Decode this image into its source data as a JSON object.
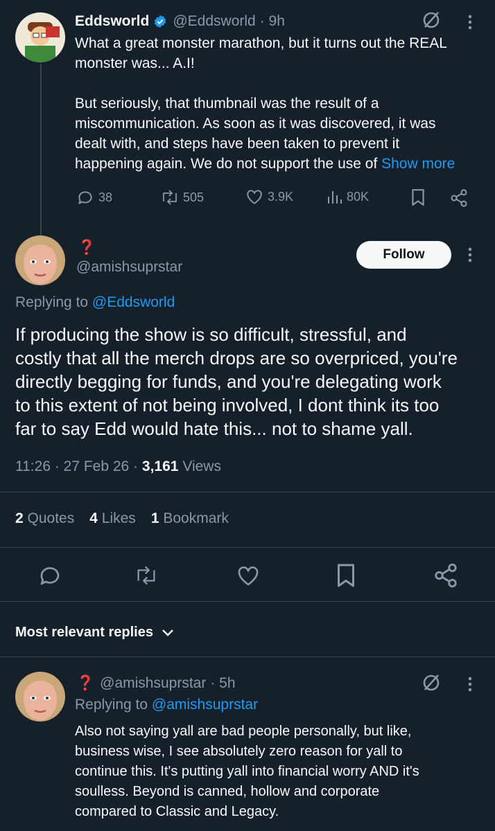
{
  "parent_tweet": {
    "display_name": "Eddsworld",
    "handle": "@Eddsworld",
    "time": "· 9h",
    "text_line1": "What a great monster marathon, but it turns out the REAL",
    "text_line2": "monster was... A.I!",
    "text_line3": "But seriously, that thumbnail was the result of a",
    "text_line4": "miscommunication. As soon as it was discovered, it was",
    "text_line5": "dealt with, and steps have been taken to prevent it",
    "text_line6": "happening again. We do not support the use of",
    "show_more": "Show more",
    "replies": "38",
    "reposts": "505",
    "likes": "3.9K",
    "views": "80K"
  },
  "main_tweet": {
    "display_name_glyph": "❓",
    "handle": "@amishsuprstar",
    "follow_label": "Follow",
    "replying_prefix": "Replying to",
    "replying_handle": "@Eddsworld",
    "body_line1": "If producing the show is so difficult, stressful, and",
    "body_line2": "costly that all the merch drops are so overpriced, you're",
    "body_line3": "directly begging for funds, and you're delegating work",
    "body_line4": "to this extent of not being involved, I dont think its too",
    "body_line5": "far to say Edd would hate this... not to shame yall.",
    "time": "11:26 · 27 Feb 26 ·",
    "views_count": "3,161",
    "views_label": "Views",
    "quotes_count": "2",
    "quotes_label": "Quotes",
    "likes_count": "4",
    "likes_label": "Likes",
    "bookmarks_count": "1",
    "bookmarks_label": "Bookmark"
  },
  "replies_header": {
    "label": "Most relevant replies"
  },
  "reply_tweet": {
    "display_name_glyph": "❓",
    "handle": "@amishsuprstar",
    "time": "· 5h",
    "replying_prefix": "Replying to",
    "replying_handle": "@amishsuprstar",
    "line1": "Also not saying yall are bad people personally, but like,",
    "line2": "business wise, I see absolutely zero reason for yall to",
    "line3": "continue this. It's putting yall into financial worry AND it's",
    "line4": "soulless. Beyond is canned, hollow and corporate",
    "line5": "compared to Classic and Legacy."
  },
  "colors": {
    "background": "#15202b",
    "accent": "#1d9bf0",
    "muted": "#8b98a5",
    "text": "#f7f9f9",
    "verified": "#1d9bf0",
    "question_red": "#e0245e"
  },
  "icons": [
    "verified-badge-icon",
    "grok-icon",
    "more-icon",
    "reply-icon",
    "repost-icon",
    "like-icon",
    "views-icon",
    "bookmark-icon",
    "share-icon",
    "chevron-down-icon"
  ]
}
